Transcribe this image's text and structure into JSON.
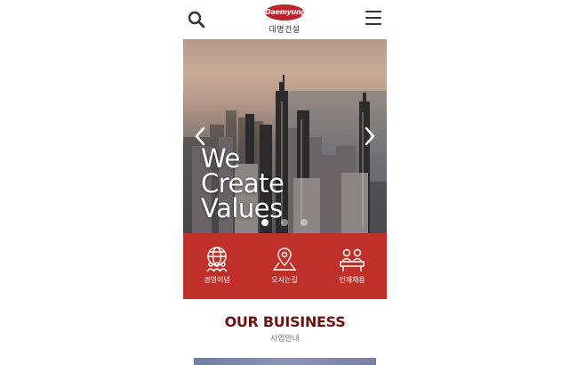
{
  "header": {
    "logo_text": "Daemyung",
    "logo_sub": "대명건설"
  },
  "icons": {
    "search": "search-icon",
    "menu": "hamburger-menu-icon",
    "prev": "chevron-left-icon",
    "next": "chevron-right-icon",
    "management": "globe-people-icon",
    "directions": "map-pin-icon",
    "recruit": "people-desk-icon"
  },
  "hero": {
    "lines": [
      "We",
      "Create",
      "Values"
    ],
    "slide_count": 3,
    "active_slide": 1
  },
  "quick_menu": [
    {
      "label": "경영이념"
    },
    {
      "label": "오시는길"
    },
    {
      "label": "인재채용"
    }
  ],
  "business": {
    "title": "OUR BUISINESS",
    "subtitle": "사업안내"
  },
  "colors": {
    "brand_red": "#c0302a",
    "title_red": "#6b1414",
    "logo_red": "#b9252b"
  }
}
